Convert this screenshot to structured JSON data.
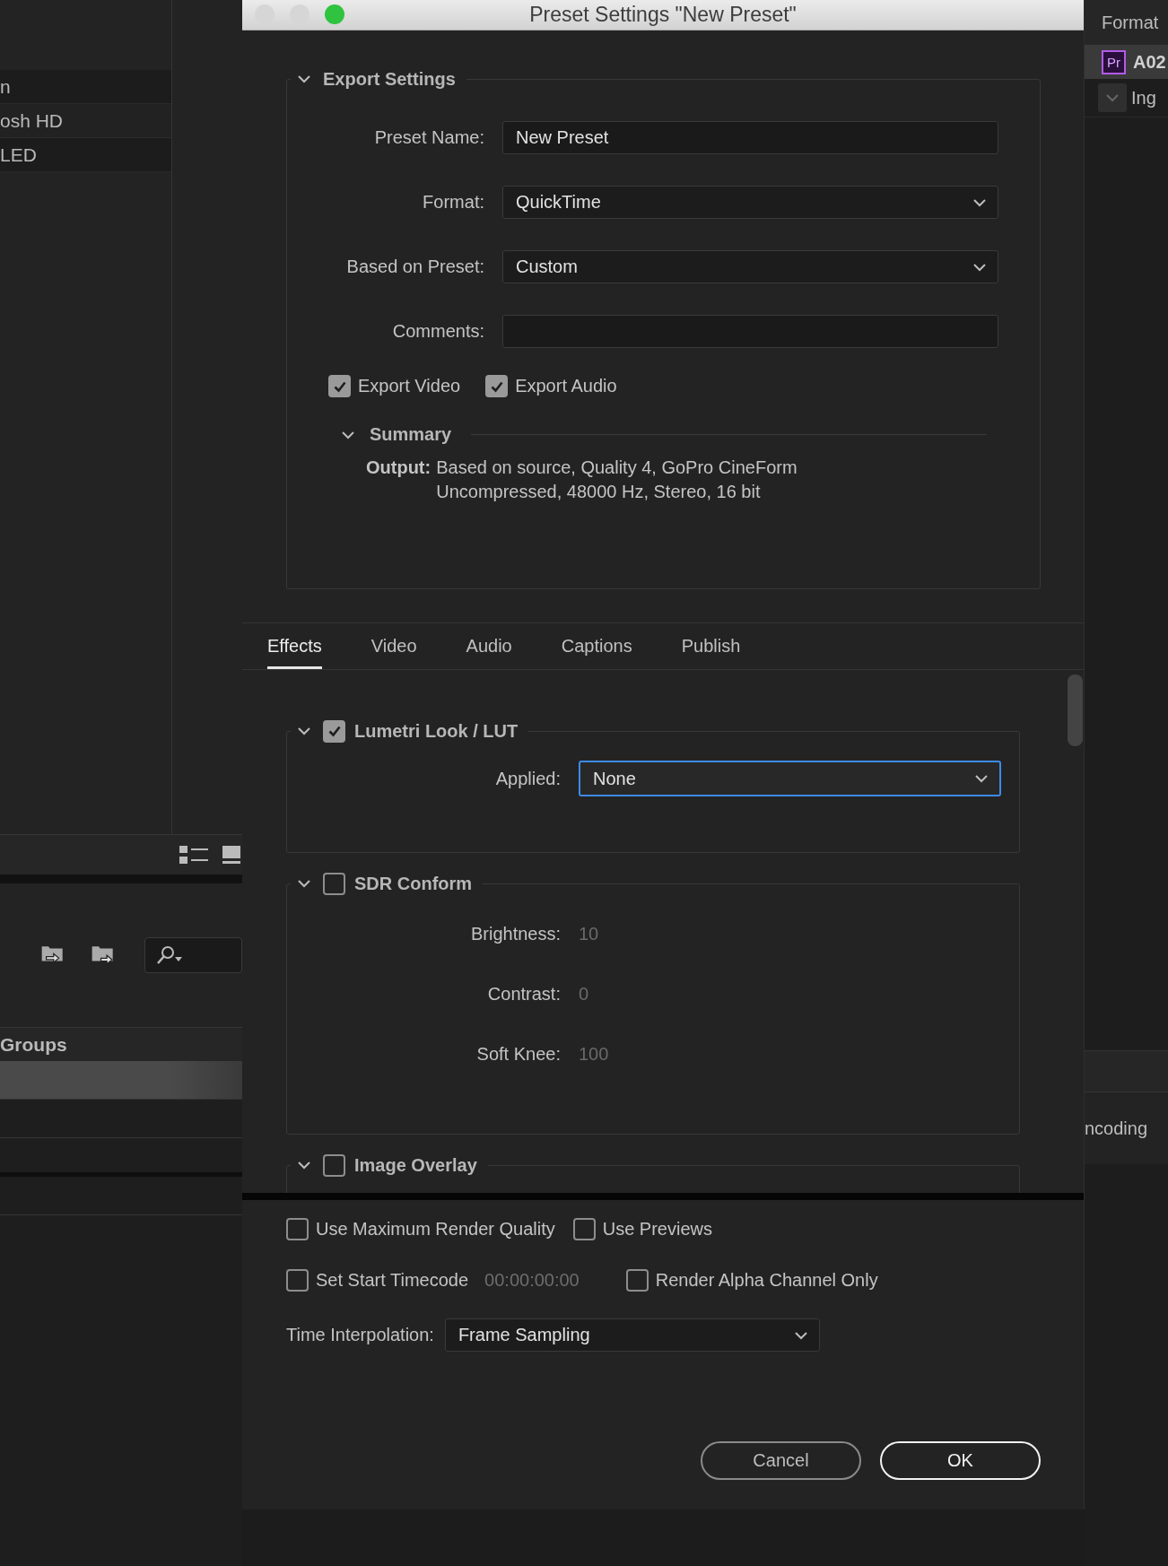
{
  "left_panel": {
    "list_rows": [
      {
        "label": "n"
      },
      {
        "label": "osh HD"
      },
      {
        "label": "LED"
      }
    ],
    "groups_header": "Groups",
    "group_rows": [
      {
        "selected": true
      },
      {
        "selected": false
      },
      {
        "selected": false
      },
      {
        "selected": false
      }
    ]
  },
  "right_panel": {
    "header": "Format",
    "rows": [
      {
        "icon_label": "Pr",
        "label": "A02",
        "selected": true
      },
      {
        "label": "Ing",
        "selected": false
      }
    ],
    "status": "ncoding"
  },
  "dialog": {
    "title": "Preset Settings \"New Preset\"",
    "traffic_lights": [
      {
        "color": "#d6d6d6"
      },
      {
        "color": "#d6d6d6"
      },
      {
        "color": "#2fc33f"
      }
    ],
    "export_settings": {
      "title": "Export Settings",
      "expanded": true,
      "fields": [
        {
          "kind": "text",
          "label": "Preset Name:",
          "value": "New Preset"
        },
        {
          "kind": "dropdown",
          "label": "Format:",
          "value": "QuickTime"
        },
        {
          "kind": "dropdown",
          "label": "Based on Preset:",
          "value": "Custom"
        },
        {
          "kind": "text",
          "label": "Comments:"
        }
      ],
      "exports": [
        {
          "label": "Export Video",
          "checked": true
        },
        {
          "label": "Export Audio",
          "checked": true
        }
      ],
      "summary": {
        "title": "Summary",
        "expanded": true,
        "output_label": "Output:",
        "output_lines": [
          "Based on source, Quality 4, GoPro CineForm",
          "Uncompressed, 48000 Hz, Stereo, 16 bit"
        ]
      }
    },
    "tabs": [
      {
        "label": "Effects",
        "selected": true
      },
      {
        "label": "Video",
        "selected": false
      },
      {
        "label": "Audio",
        "selected": false
      },
      {
        "label": "Captions",
        "selected": false
      },
      {
        "label": "Publish",
        "selected": false
      }
    ],
    "effects": [
      {
        "title": "Lumetri Look / LUT",
        "checked": true,
        "expanded": true,
        "fields": [
          {
            "kind": "dropdown",
            "label": "Applied:",
            "value": "None",
            "focused": true
          }
        ]
      },
      {
        "title": "SDR Conform",
        "checked": false,
        "expanded": true,
        "fields": [
          {
            "kind": "number",
            "label": "Brightness:",
            "value": "10",
            "disabled": true
          },
          {
            "kind": "number",
            "label": "Contrast:",
            "value": "0",
            "disabled": true
          },
          {
            "kind": "number",
            "label": "Soft Knee:",
            "value": "100",
            "disabled": true
          }
        ]
      },
      {
        "title": "Image Overlay",
        "checked": false,
        "expanded": true
      }
    ],
    "options": [
      {
        "label": "Use Maximum Render Quality",
        "checked": false
      },
      {
        "label": "Use Previews",
        "checked": false
      },
      {
        "label": "Set Start Timecode",
        "checked": false,
        "value": "00:00:00:00",
        "disabled": true
      },
      {
        "label": "Render Alpha Channel Only",
        "checked": false
      }
    ],
    "time_interpolation": {
      "label": "Time Interpolation:",
      "value": "Frame Sampling"
    },
    "buttons": [
      {
        "label": "Cancel",
        "default": false
      },
      {
        "label": "OK",
        "default": true
      }
    ]
  }
}
